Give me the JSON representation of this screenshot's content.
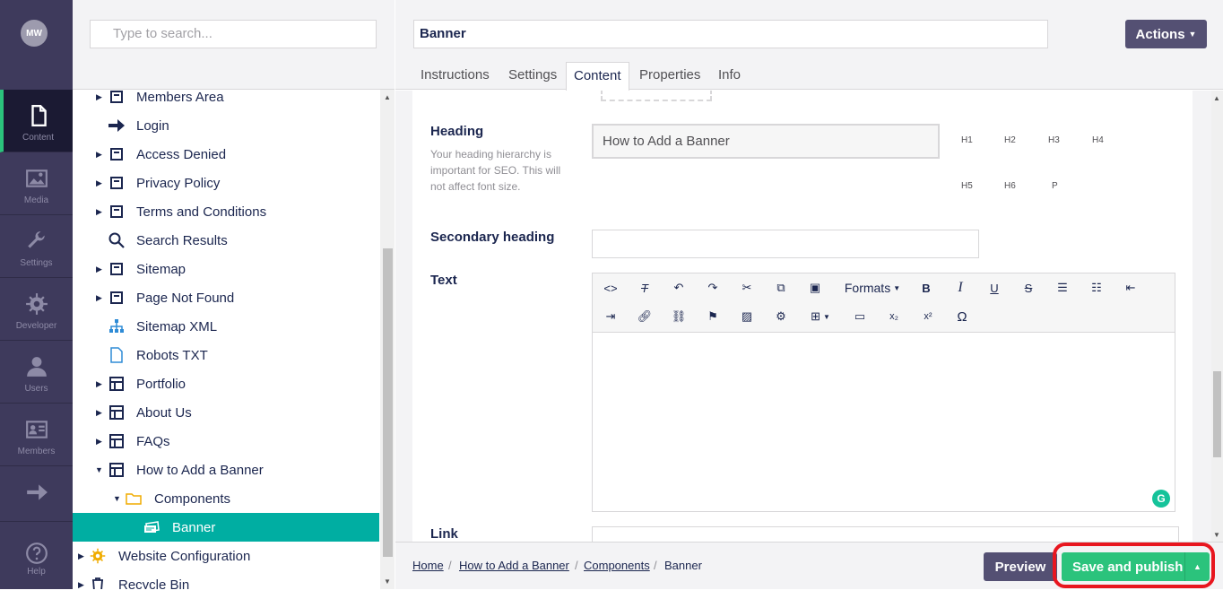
{
  "avatar": {
    "initials": "MW"
  },
  "nav": [
    {
      "label": "Content",
      "icon": "document-icon"
    },
    {
      "label": "Media",
      "icon": "image-icon"
    },
    {
      "label": "Settings",
      "icon": "wrench-icon"
    },
    {
      "label": "Developer",
      "icon": "gear-icon"
    },
    {
      "label": "Users",
      "icon": "user-icon"
    },
    {
      "label": "Members",
      "icon": "id-card-icon"
    },
    {
      "label": "",
      "icon": "arrow-right-icon"
    },
    {
      "label": "Help",
      "icon": "help-icon"
    }
  ],
  "tree": {
    "search_placeholder": "Type to search...",
    "items": [
      {
        "label": "Members Area",
        "icon": "page-icon"
      },
      {
        "label": "Login",
        "icon": "arrow-right-icon"
      },
      {
        "label": "Access Denied",
        "icon": "page-icon"
      },
      {
        "label": "Privacy Policy",
        "icon": "page-icon"
      },
      {
        "label": "Terms and Conditions",
        "icon": "page-icon"
      },
      {
        "label": "Search Results",
        "icon": "search-icon"
      },
      {
        "label": "Sitemap",
        "icon": "page-icon"
      },
      {
        "label": "Page Not Found",
        "icon": "page-icon"
      },
      {
        "label": "Sitemap XML",
        "icon": "sitemap-icon"
      },
      {
        "label": "Robots TXT",
        "icon": "file-icon"
      },
      {
        "label": "Portfolio",
        "icon": "layout-icon"
      },
      {
        "label": "About Us",
        "icon": "layout-icon"
      },
      {
        "label": "FAQs",
        "icon": "layout-icon"
      },
      {
        "label": "How to Add a Banner",
        "icon": "layout-icon"
      },
      {
        "label": "Components",
        "icon": "folder-icon"
      },
      {
        "label": "Banner",
        "icon": "banner-icon"
      },
      {
        "label": "Website Configuration",
        "icon": "settings-icon"
      },
      {
        "label": "Recycle Bin",
        "icon": "trash-icon"
      }
    ]
  },
  "editor": {
    "name": "Banner",
    "actions_label": "Actions",
    "tabs": [
      "Instructions",
      "Settings",
      "Content",
      "Properties",
      "Info"
    ],
    "heading": {
      "label": "Heading",
      "description": "Your heading hierarchy is important for SEO. This will not affect font size.",
      "value": "How to Add a Banner",
      "levels": [
        "H1",
        "H2",
        "H3",
        "H4",
        "H5",
        "H6",
        "P"
      ]
    },
    "secondary_heading": {
      "label": "Secondary heading",
      "value": ""
    },
    "text": {
      "label": "Text",
      "formats_label": "Formats"
    },
    "link": {
      "label": "Link"
    }
  },
  "footer": {
    "breadcrumbs": [
      "Home",
      "How to Add a Banner",
      "Components",
      "Banner"
    ],
    "preview_label": "Preview",
    "save_label": "Save and publish"
  },
  "colors": {
    "sidebar": "#3e3a5c",
    "accent": "#00aea2",
    "save": "#2bc37c",
    "highlight": "#e8161f"
  }
}
